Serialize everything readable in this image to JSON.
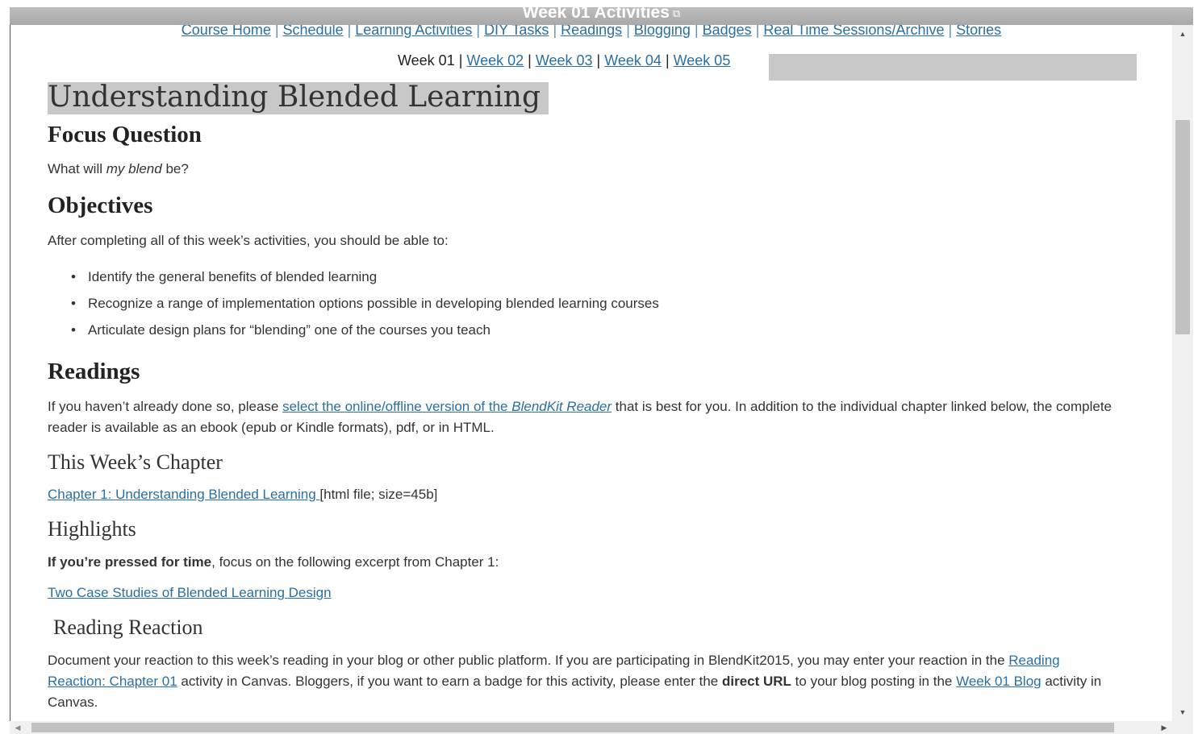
{
  "window": {
    "title": "Week 01 Activities"
  },
  "top_nav": [
    "Course Home",
    "Schedule",
    "Learning Activities",
    "DIY Tasks",
    "Readings",
    "Blogging",
    "Badges",
    "Real Time Sessions/Archive",
    "Stories"
  ],
  "week_nav": {
    "current": "Week 01",
    "links": [
      "Week 02",
      "Week 03",
      "Week 04",
      "Week 05"
    ]
  },
  "page": {
    "title": "Understanding Blended Learning",
    "focus": {
      "heading": "Focus Question",
      "text_before": "What will ",
      "text_em": "my blend",
      "text_after": " be?"
    },
    "objectives": {
      "heading": "Objectives",
      "intro": "After completing all of this week’s activities, you should be able to:",
      "items": [
        "Identify the general benefits of blended learning",
        "Recognize a range of implementation options possible in developing blended learning courses",
        "Articulate design plans for “blending” one of the courses you teach"
      ]
    },
    "readings": {
      "heading": "Readings",
      "text1": "If you haven’t already done so, please ",
      "link_text": "select the online/offline version of the ",
      "link_em": "BlendKit Reader",
      "text2": " that is best for you. In addition to the individual chapter linked below, the complete reader is available as an ebook (epub or Kindle formats), pdf, or in HTML."
    },
    "chapter": {
      "heading": "This Week’s Chapter",
      "link": "Chapter 1: Understanding Blended Learning ",
      "meta": "[html file; size=45b]"
    },
    "highlights": {
      "heading": "Highlights",
      "bold": "If you’re pressed for time",
      "text": ", focus on the following excerpt from Chapter 1:",
      "link": "Two Case Studies of Blended Learning Design"
    },
    "reaction": {
      "heading": "Reading Reaction",
      "t1": "Document your reaction to this week’s reading  in your blog or other public platform.  If you are participating in BlendKit2015, you may enter your reaction in the ",
      "link1": "Reading Reaction: Chapter 01",
      "t2": " activity in Canvas.  Bloggers, if you want to earn a badge for this activity, please enter the ",
      "bold": "direct URL",
      "t3": " to your blog posting in the ",
      "link2": "Week 01 Blog",
      "t4": " activity in Canvas."
    }
  }
}
